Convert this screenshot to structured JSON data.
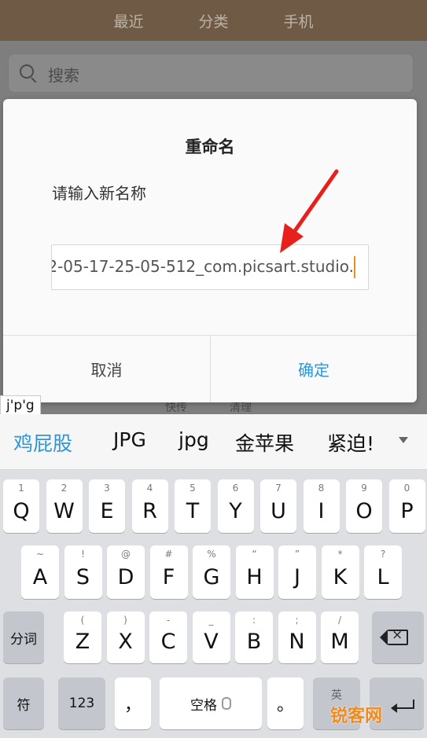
{
  "background_app": {
    "tabs": [
      "最近",
      "分类",
      "手机"
    ],
    "search_placeholder": "搜索",
    "obscured_under_dialog": [
      "快传",
      "清理"
    ]
  },
  "dialog": {
    "title": "重命名",
    "prompt": "请输入新名称",
    "input_value": "2-05-17-25-05-512_com.picsart.studio.",
    "cancel_label": "取消",
    "confirm_label": "确定"
  },
  "keyboard": {
    "composing_text": "j'p'g",
    "candidates": [
      "鸡屁股",
      "JPG",
      "jpg",
      "金苹果",
      "紧迫!"
    ],
    "row1": [
      {
        "sub": "1",
        "main": "Q"
      },
      {
        "sub": "2",
        "main": "W"
      },
      {
        "sub": "3",
        "main": "E"
      },
      {
        "sub": "4",
        "main": "R"
      },
      {
        "sub": "5",
        "main": "T"
      },
      {
        "sub": "6",
        "main": "Y"
      },
      {
        "sub": "7",
        "main": "U"
      },
      {
        "sub": "8",
        "main": "I"
      },
      {
        "sub": "9",
        "main": "O"
      },
      {
        "sub": "0",
        "main": "P"
      }
    ],
    "row2": [
      {
        "sub": "~",
        "main": "A"
      },
      {
        "sub": "!",
        "main": "S"
      },
      {
        "sub": "@",
        "main": "D"
      },
      {
        "sub": "#",
        "main": "F"
      },
      {
        "sub": "%",
        "main": "G"
      },
      {
        "sub": "“",
        "main": "H"
      },
      {
        "sub": "”",
        "main": "J"
      },
      {
        "sub": "*",
        "main": "K"
      },
      {
        "sub": "?",
        "main": "L"
      }
    ],
    "row3": [
      {
        "sub": "(",
        "main": "Z"
      },
      {
        "sub": ")",
        "main": "X"
      },
      {
        "sub": "-",
        "main": "C"
      },
      {
        "sub": "_",
        "main": "V"
      },
      {
        "sub": ":",
        "main": "B"
      },
      {
        "sub": ";",
        "main": "N"
      },
      {
        "sub": "/",
        "main": "M"
      }
    ],
    "segment_label": "分词",
    "symbol_label": "符",
    "numeric_label": "123",
    "comma_label": "，",
    "space_label": "空格",
    "period_label": "。",
    "lang_label": "英"
  },
  "watermark": "锐客网",
  "colors": {
    "accent_blue": "#2f96d6",
    "annotation_arrow": "#e8201c",
    "caret": "#e9901c",
    "tabbar": "#6f5a46"
  }
}
